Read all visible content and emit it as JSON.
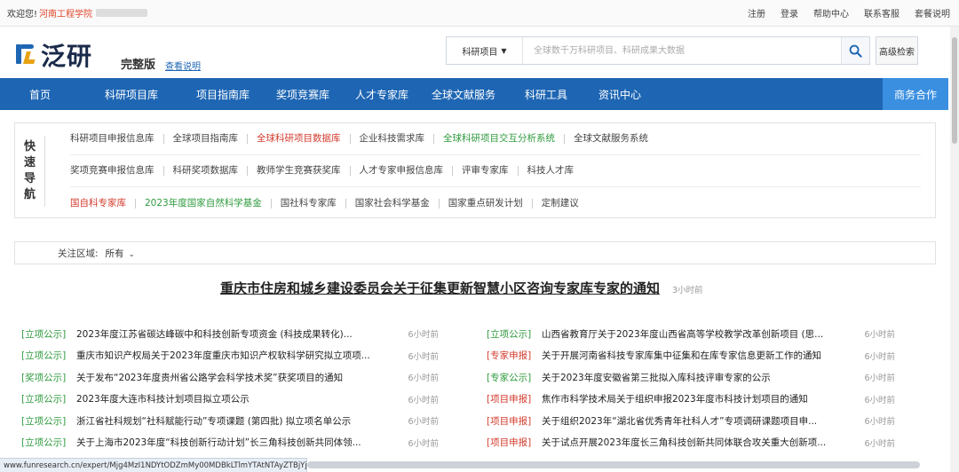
{
  "topbar": {
    "welcome": "欢迎您!",
    "school": "河南工程学院",
    "links": [
      "注册",
      "登录",
      "帮助中心",
      "联系客服",
      "套餐说明"
    ]
  },
  "header": {
    "logo_text": "泛研",
    "edition": "完整版",
    "edition_link": "查看说明",
    "search": {
      "select_label": "科研项目",
      "placeholder": "全球数千万科研项目、科研成果大数据",
      "advanced": "高级检索"
    }
  },
  "nav": {
    "items": [
      "首页",
      "科研项目库",
      "项目指南库",
      "奖项竞赛库",
      "人才专家库",
      "全球文献服务",
      "科研工具",
      "资讯中心"
    ],
    "cta": "商务合作"
  },
  "quick_nav": {
    "label": [
      "快",
      "速",
      "导",
      "航"
    ],
    "rows": [
      [
        {
          "text": "科研项目申报信息库",
          "color": "normal"
        },
        {
          "text": "全球项目指南库",
          "color": "normal"
        },
        {
          "text": "全球科研项目数据库",
          "color": "red"
        },
        {
          "text": "企业科技需求库",
          "color": "normal"
        },
        {
          "text": "全球科研项目交互分析系统",
          "color": "green"
        },
        {
          "text": "全球文献服务系统",
          "color": "normal"
        }
      ],
      [
        {
          "text": "奖项竞赛申报信息库",
          "color": "normal"
        },
        {
          "text": "科研奖项数据库",
          "color": "normal"
        },
        {
          "text": "教师学生竞赛获奖库",
          "color": "normal"
        },
        {
          "text": "人才专家申报信息库",
          "color": "normal"
        },
        {
          "text": "评审专家库",
          "color": "normal"
        },
        {
          "text": "科技人才库",
          "color": "normal"
        }
      ],
      [
        {
          "text": "国自科专家库",
          "color": "red"
        },
        {
          "text": "2023年度国家自然科学基金",
          "color": "green"
        },
        {
          "text": "国社科专家库",
          "color": "normal"
        },
        {
          "text": "国家社会科学基金",
          "color": "normal"
        },
        {
          "text": "国家重点研发计划",
          "color": "normal"
        },
        {
          "text": "定制建议",
          "color": "normal"
        }
      ]
    ]
  },
  "filter": {
    "label": "关注区域:",
    "value": "所有"
  },
  "headline": {
    "title": "重庆市住房和城乡建设委员会关于征集更新智慧小区咨询专家库专家的通知",
    "time": "3小时前"
  },
  "news_left": [
    {
      "tag": "[立项公示]",
      "color": "green",
      "text": "2023年度江苏省碳达峰碳中和科技创新专项资金 (科技成果转化)...",
      "time": "6小时前"
    },
    {
      "tag": "[立项公示]",
      "color": "green",
      "text": "重庆市知识产权局关于2023年度重庆市知识产权软科学研究拟立项项...",
      "time": "6小时前"
    },
    {
      "tag": "[奖项公示]",
      "color": "green",
      "text": "关于发布“2023年度贵州省公路学会科学技术奖”获奖项目的通知",
      "time": "6小时前"
    },
    {
      "tag": "[立项公示]",
      "color": "green",
      "text": "2023年度大连市科技计划项目拟立项公示",
      "time": "6小时前"
    },
    {
      "tag": "[立项公示]",
      "color": "green",
      "text": "浙江省社科规划“社科赋能行动”专项课题 (第四批) 拟立项名单公示",
      "time": "6小时前"
    },
    {
      "tag": "[立项公示]",
      "color": "green",
      "text": "关于上海市2023年度“科技创新行动计划”长三角科技创新共同体领...",
      "time": "6小时前"
    }
  ],
  "news_right": [
    {
      "tag": "[立项公示]",
      "color": "green",
      "text": "山西省教育厅关于2023年度山西省高等学校教学改革创新项目 (思...",
      "time": "6小时前"
    },
    {
      "tag": "[专家申报]",
      "color": "red",
      "text": "关于开展河南省科技专家库集中征集和在库专家信息更新工作的通知",
      "time": "6小时前"
    },
    {
      "tag": "[专家公示]",
      "color": "green",
      "text": "关于2023年度安徽省第三批拟入库科技评审专家的公示",
      "time": "6小时前"
    },
    {
      "tag": "[项目申报]",
      "color": "red",
      "text": "焦作市科学技术局关于组织申报2023年度市科技计划项目的通知",
      "time": "6小时前"
    },
    {
      "tag": "[项目申报]",
      "color": "red",
      "text": "关于组织2023年“湖北省优秀青年社科人才”专项调研课题项目申...",
      "time": "6小时前"
    },
    {
      "tag": "[项目申报]",
      "color": "red",
      "text": "关于试点开展2023年度长三角科技创新共同体联合攻关重大创新项...",
      "time": "6小时前"
    }
  ],
  "statusbar": {
    "url": "www.funresearch.cn/expert/Mjg4MzI1NDYtODZmMy00MDBkLTlmYTAtNTAyZTBjYjFmOTA4"
  },
  "colors": {
    "brand_blue": "#1e66b3",
    "accent_red": "#d33b2d",
    "accent_green": "#2e9a3d"
  }
}
